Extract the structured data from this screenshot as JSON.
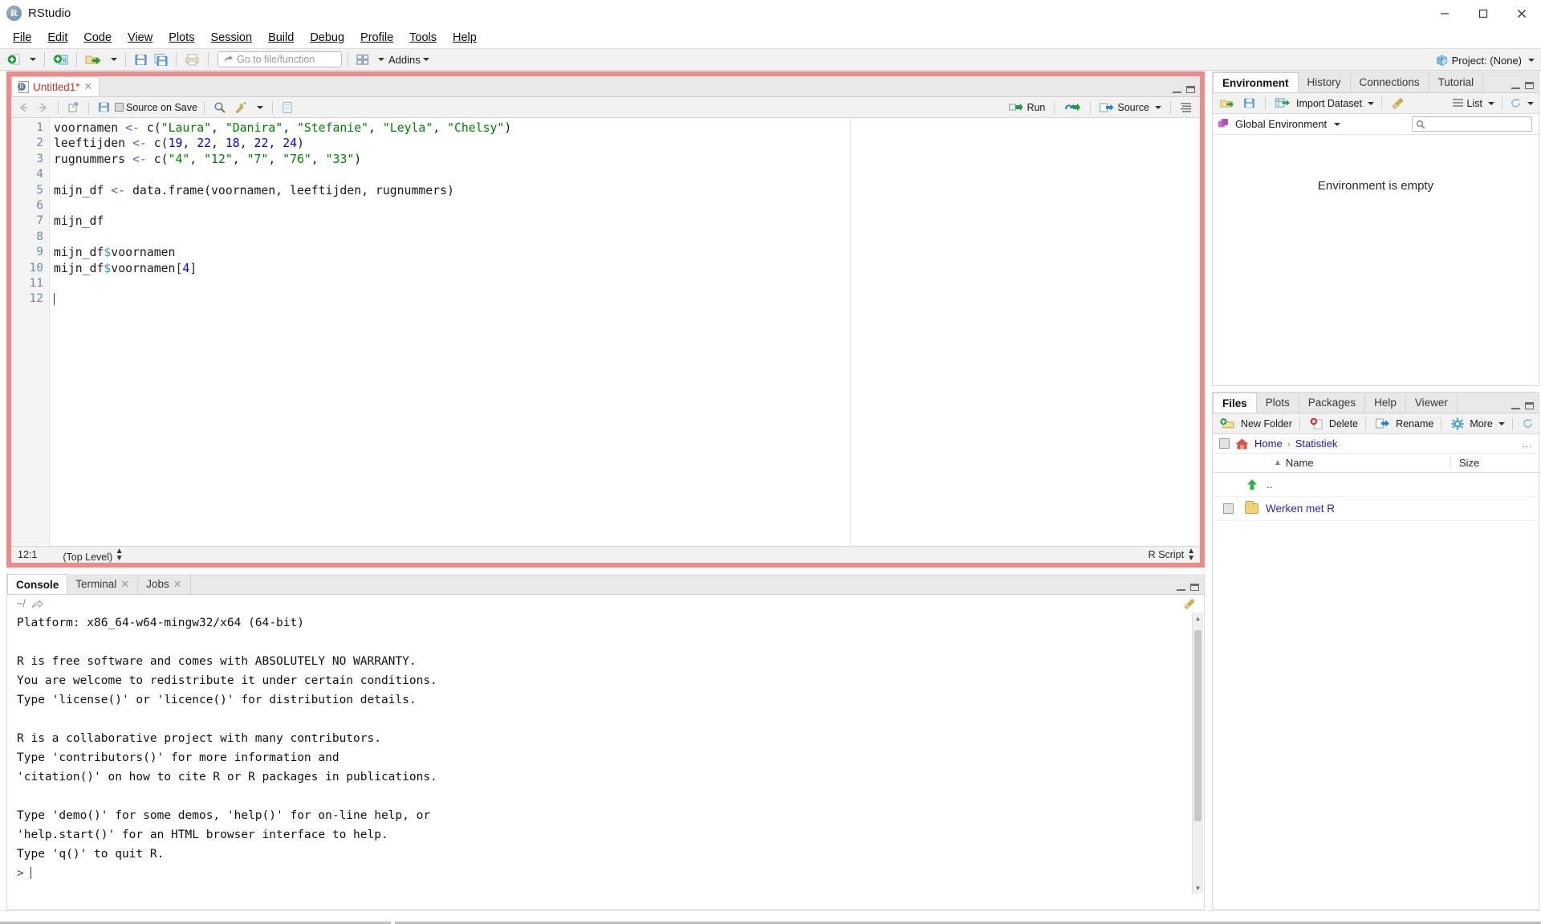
{
  "window": {
    "app_name": "RStudio",
    "logo_letter": "R",
    "controls": {
      "minimize": "—",
      "maximize": "❐",
      "close": "✕"
    }
  },
  "menu": {
    "items": [
      {
        "label": "File"
      },
      {
        "label": "Edit"
      },
      {
        "label": "Code"
      },
      {
        "label": "View"
      },
      {
        "label": "Plots"
      },
      {
        "label": "Session"
      },
      {
        "label": "Build"
      },
      {
        "label": "Debug"
      },
      {
        "label": "Profile"
      },
      {
        "label": "Tools"
      },
      {
        "label": "Help"
      }
    ]
  },
  "toolbar": {
    "new_file_icon": "new-file-icon",
    "new_project_icon": "new-project-icon",
    "open_icon": "open-file-icon",
    "save_icon": "save-icon",
    "save_all_icon": "save-all-icon",
    "print_icon": "print-icon",
    "goto_placeholder": "Go to file/function",
    "workspace_panes_icon": "panes-icon",
    "addins_label": "Addins",
    "project_label": "Project: (None)"
  },
  "source_pane": {
    "tab": {
      "label": "Untitled1*",
      "close": "✕",
      "icon": "r-script-icon"
    },
    "toolbar": {
      "back_icon": "back-arrow-icon",
      "forward_icon": "forward-arrow-icon",
      "popout_icon": "show-in-new-window-icon",
      "save_icon": "save-icon",
      "source_on_save_label": "Source on Save",
      "find_icon": "search-icon",
      "magic_icon": "code-tools-icon",
      "compile_icon": "compile-report-icon",
      "run_label": "Run",
      "rerun_icon": "re-run-icon",
      "source_label": "Source",
      "outline_icon": "document-outline-icon"
    },
    "code_lines": [
      {
        "n": "1",
        "tokens": [
          {
            "t": "voornamen ",
            "c": "plain"
          },
          {
            "t": "<-",
            "c": "op"
          },
          {
            "t": " c(",
            "c": "plain"
          },
          {
            "t": "\"Laura\"",
            "c": "str"
          },
          {
            "t": ", ",
            "c": "plain"
          },
          {
            "t": "\"Danira\"",
            "c": "str"
          },
          {
            "t": ", ",
            "c": "plain"
          },
          {
            "t": "\"Stefanie\"",
            "c": "str"
          },
          {
            "t": ", ",
            "c": "plain"
          },
          {
            "t": "\"Leyla\"",
            "c": "str"
          },
          {
            "t": ", ",
            "c": "plain"
          },
          {
            "t": "\"Chelsy\"",
            "c": "str"
          },
          {
            "t": ")",
            "c": "plain"
          }
        ]
      },
      {
        "n": "2",
        "tokens": [
          {
            "t": "leeftijden ",
            "c": "plain"
          },
          {
            "t": "<-",
            "c": "op"
          },
          {
            "t": " c(",
            "c": "plain"
          },
          {
            "t": "19",
            "c": "num"
          },
          {
            "t": ", ",
            "c": "plain"
          },
          {
            "t": "22",
            "c": "num"
          },
          {
            "t": ", ",
            "c": "plain"
          },
          {
            "t": "18",
            "c": "num"
          },
          {
            "t": ", ",
            "c": "plain"
          },
          {
            "t": "22",
            "c": "num"
          },
          {
            "t": ", ",
            "c": "plain"
          },
          {
            "t": "24",
            "c": "num"
          },
          {
            "t": ")",
            "c": "plain"
          }
        ]
      },
      {
        "n": "3",
        "tokens": [
          {
            "t": "rugnummers ",
            "c": "plain"
          },
          {
            "t": "<-",
            "c": "op"
          },
          {
            "t": " c(",
            "c": "plain"
          },
          {
            "t": "\"4\"",
            "c": "str"
          },
          {
            "t": ", ",
            "c": "plain"
          },
          {
            "t": "\"12\"",
            "c": "str"
          },
          {
            "t": ", ",
            "c": "plain"
          },
          {
            "t": "\"7\"",
            "c": "str"
          },
          {
            "t": ", ",
            "c": "plain"
          },
          {
            "t": "\"76\"",
            "c": "str"
          },
          {
            "t": ", ",
            "c": "plain"
          },
          {
            "t": "\"33\"",
            "c": "str"
          },
          {
            "t": ")",
            "c": "plain"
          }
        ]
      },
      {
        "n": "4",
        "tokens": []
      },
      {
        "n": "5",
        "tokens": [
          {
            "t": "mijn_df ",
            "c": "plain"
          },
          {
            "t": "<-",
            "c": "op"
          },
          {
            "t": " data.frame(voornamen, leeftijden, rugnummers)",
            "c": "plain"
          }
        ]
      },
      {
        "n": "6",
        "tokens": []
      },
      {
        "n": "7",
        "tokens": [
          {
            "t": "mijn_df",
            "c": "plain"
          }
        ]
      },
      {
        "n": "8",
        "tokens": []
      },
      {
        "n": "9",
        "tokens": [
          {
            "t": "mijn_df",
            "c": "plain"
          },
          {
            "t": "$",
            "c": "dollar"
          },
          {
            "t": "voornamen",
            "c": "plain"
          }
        ]
      },
      {
        "n": "10",
        "tokens": [
          {
            "t": "mijn_df",
            "c": "plain"
          },
          {
            "t": "$",
            "c": "dollar"
          },
          {
            "t": "voornamen",
            "c": "plain"
          },
          {
            "t": "[",
            "c": "brk"
          },
          {
            "t": "4",
            "c": "num"
          },
          {
            "t": "]",
            "c": "brk"
          }
        ]
      },
      {
        "n": "11",
        "tokens": []
      },
      {
        "n": "12",
        "tokens": [],
        "cursor": true
      }
    ],
    "status": {
      "cursor_position": "12:1",
      "scope": "(Top Level)",
      "file_type": "R Script"
    }
  },
  "console_pane": {
    "tabs": [
      {
        "label": "Console",
        "closable": false,
        "active": true
      },
      {
        "label": "Terminal",
        "closable": true,
        "active": false
      },
      {
        "label": "Jobs",
        "closable": true,
        "active": false
      }
    ],
    "close_glyph": "✕",
    "working_dir": "~/",
    "popout_icon": "open-in-new-window-icon",
    "output": "Platform: x86_64-w64-mingw32/x64 (64-bit)\n\nR is free software and comes with ABSOLUTELY NO WARRANTY.\nYou are welcome to redistribute it under certain conditions.\nType 'license()' or 'licence()' for distribution details.\n\nR is a collaborative project with many contributors.\nType 'contributors()' for more information and\n'citation()' on how to cite R or R packages in publications.\n\nType 'demo()' for some demos, 'help()' for on-line help, or\n'help.start()' for an HTML browser interface to help.\nType 'q()' to quit R.\n",
    "prompt": ">"
  },
  "environment_pane": {
    "tabs": [
      {
        "label": "Environment",
        "active": true
      },
      {
        "label": "History",
        "active": false
      },
      {
        "label": "Connections",
        "active": false
      },
      {
        "label": "Tutorial",
        "active": false
      }
    ],
    "toolbar": {
      "load_icon": "load-workspace-icon",
      "save_icon": "save-workspace-icon",
      "import_label": "Import Dataset",
      "broom_icon": "clear-objects-icon",
      "list_label": "List",
      "refresh_icon": "refresh-icon"
    },
    "scope_label": "Global Environment",
    "scope_icon": "cube-icon",
    "search_placeholder": "",
    "search_icon": "search-icon",
    "empty_message": "Environment is empty"
  },
  "files_pane": {
    "tabs": [
      {
        "label": "Files",
        "active": true
      },
      {
        "label": "Plots",
        "active": false
      },
      {
        "label": "Packages",
        "active": false
      },
      {
        "label": "Help",
        "active": false
      },
      {
        "label": "Viewer",
        "active": false
      }
    ],
    "toolbar": {
      "new_folder_label": "New Folder",
      "new_folder_icon": "new-folder-icon",
      "delete_label": "Delete",
      "delete_icon": "delete-icon",
      "rename_label": "Rename",
      "rename_icon": "rename-icon",
      "more_label": "More",
      "more_icon": "gear-icon",
      "refresh_icon": "refresh-icon"
    },
    "breadcrumb": {
      "home_icon": "home-icon",
      "items": [
        "Home",
        "Statistiek"
      ],
      "separator": "›",
      "overflow": "…"
    },
    "columns": [
      {
        "label": "Name",
        "sort": "▲"
      },
      {
        "label": "Size"
      }
    ],
    "rows": [
      {
        "name": "..",
        "icon": "up-arrow-icon",
        "has_checkbox": false
      },
      {
        "name": "Werken met R",
        "icon": "folder-icon",
        "has_checkbox": true
      }
    ]
  },
  "colors": {
    "highlight_border": "#ef8a8a",
    "string": "#008000",
    "number": "#0000cd",
    "operator": "#4169b0",
    "dollar": "#3a9aa8",
    "link": "#1a1aa8",
    "tab_modified": "#c0392b"
  }
}
